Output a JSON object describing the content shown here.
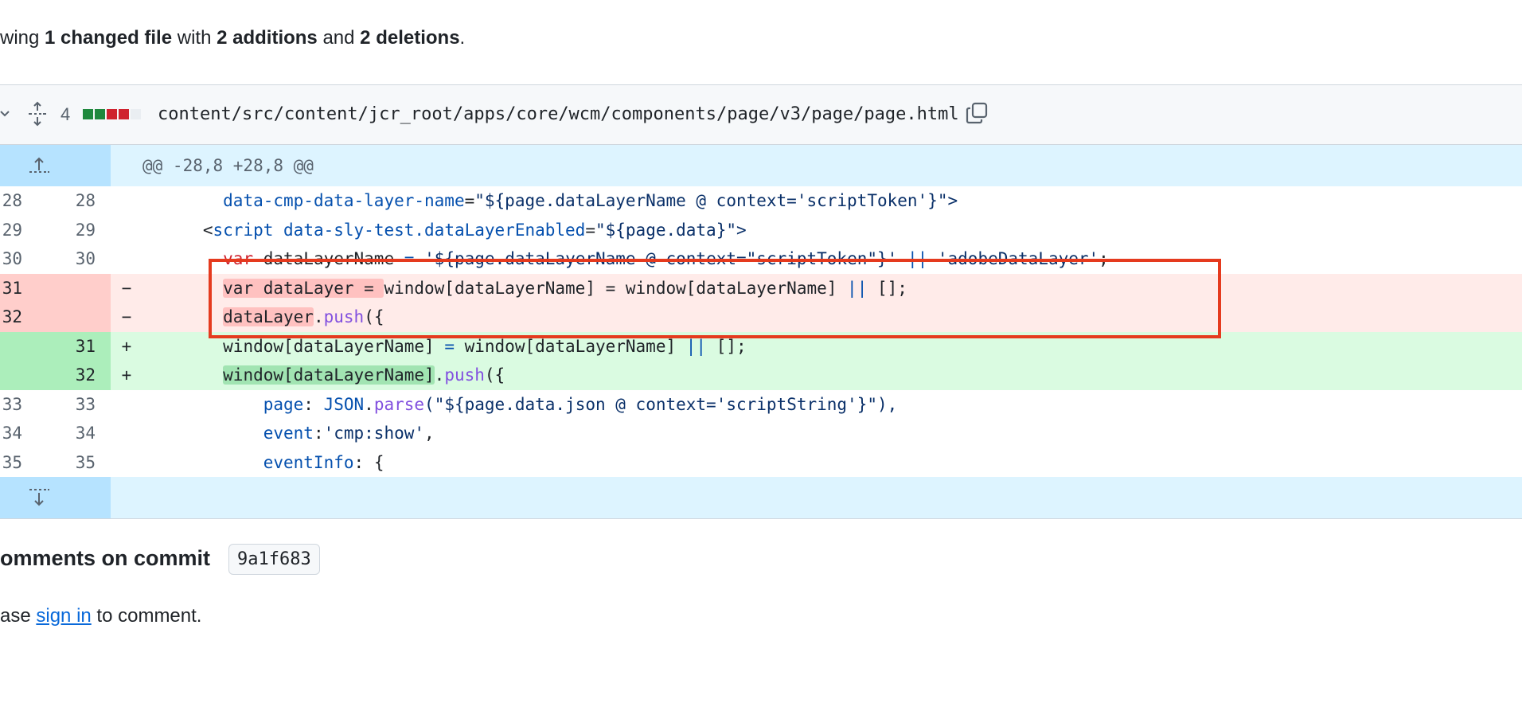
{
  "summary": {
    "prefix": "wing ",
    "changed": "1 changed file",
    "with": " with ",
    "additions": "2 additions",
    "and": " and ",
    "deletions": "2 deletions",
    "end": "."
  },
  "file": {
    "change_count": "4",
    "path": "content/src/content/jcr_root/apps/core/wcm/components/page/v3/page/page.html",
    "diffstat_colors": [
      "#1f883d",
      "#1f883d",
      "#cf222e",
      "#cf222e",
      "#eaeef2"
    ]
  },
  "hunk": {
    "header": "@@ -28,8 +28,8 @@"
  },
  "lines": [
    {
      "old": "28",
      "new": "28",
      "sign": ""
    },
    {
      "old": "29",
      "new": "29",
      "sign": ""
    },
    {
      "old": "30",
      "new": "30",
      "sign": ""
    },
    {
      "old": "31",
      "new": "",
      "sign": "−"
    },
    {
      "old": "32",
      "new": "",
      "sign": "−"
    },
    {
      "old": "",
      "new": "31",
      "sign": "+"
    },
    {
      "old": "",
      "new": "32",
      "sign": "+"
    },
    {
      "old": "33",
      "new": "33",
      "sign": ""
    },
    {
      "old": "34",
      "new": "34",
      "sign": ""
    },
    {
      "old": "35",
      "new": "35",
      "sign": ""
    }
  ],
  "code": {
    "l28": {
      "indent": "        ",
      "attr": "data-cmp-data-layer-name",
      "eq": "=",
      "val": "\"${page.dataLayerName @ context='scriptToken'}\">"
    },
    "l29": {
      "indent": "      ",
      "lt": "<",
      "tag": "script",
      "sp": " ",
      "attr": "data-sly-test.dataLayerEnabled",
      "eq": "=",
      "val": "\"${page.data}\">"
    },
    "l30": {
      "indent": "        ",
      "kw": "var",
      "name": " dataLayerName ",
      "eq": "=",
      "sp": " ",
      "val": "'${page.dataLayerName @ context=\"scriptToken\"}'",
      "or": " || ",
      "val2": "'adobeDataLayer'",
      "semi": ";"
    },
    "l31": {
      "indent": "        ",
      "hl": "var dataLayer = ",
      "rest": "window[dataLayerName] = window[dataLayerName] ",
      "or": "||",
      "end": " [];"
    },
    "l32": {
      "indent": "        ",
      "hl": "dataLayer",
      "dot": ".",
      "fn": "push",
      "end": "({"
    },
    "n31": {
      "indent": "        ",
      "text": "window[dataLayerName] ",
      "eq": "=",
      "text2": " window[dataLayerName] ",
      "or": "||",
      "end": " [];"
    },
    "n32": {
      "indent": "        ",
      "hl": "window[dataLayerName]",
      "dot": ".",
      "fn": "push",
      "end": "({"
    },
    "l33": {
      "indent": "            ",
      "key": "page",
      "colon": ": ",
      "obj": "JSON",
      "dot": ".",
      "fn": "parse",
      "val": "(\"${page.data.json @ context='scriptString'}\"),",
      "end": ""
    },
    "l34": {
      "indent": "            ",
      "key": "event",
      "colon": ":",
      "val": "'cmp:show'",
      "end": ","
    },
    "l35": {
      "indent": "            ",
      "key": "eventInfo",
      "colon": ": ",
      "end": "{"
    }
  },
  "comments": {
    "title": "omments on commit",
    "commit": "9a1f683",
    "pre": "ase ",
    "link": "sign in",
    "post": " to comment."
  },
  "icons": {
    "chevron": "chevron-down-icon",
    "expand": "unfold-icon",
    "copy": "copy-icon",
    "expand_up": "expand-up-icon",
    "expand_down": "expand-down-icon"
  }
}
